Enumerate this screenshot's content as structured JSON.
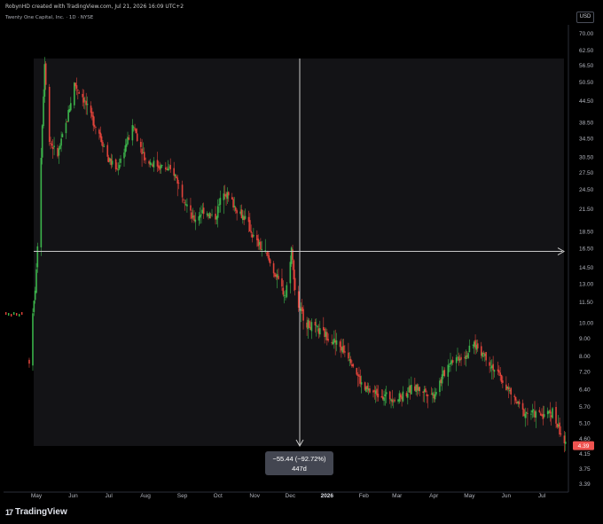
{
  "header": {
    "credit": "RobynHD created with TradingView.com, Jul 21, 2026 16:09 UTC+2",
    "symbol": "Twenty One Capital, Inc. · 1D · NYSE",
    "currency": "USD"
  },
  "footer": {
    "brand": "TradingView"
  },
  "colors": {
    "up": "#26a69a",
    "down": "#ef5350",
    "upBright": "#3cb44b",
    "downBright": "#e0433a",
    "background": "#000000",
    "plotArea": "#131316",
    "crosshair": "#c8c8c8"
  },
  "measure": {
    "change": "−55.44 (−92.72%)",
    "bars": "447d"
  },
  "last_price": "4.39",
  "chart_data": {
    "type": "candlestick",
    "title": "",
    "xlabel": "",
    "ylabel": "",
    "x_tick_labels": [
      "May",
      "Jun",
      "Jul",
      "Aug",
      "Sep",
      "Oct",
      "Nov",
      "Dec",
      "2026",
      "Feb",
      "Mar",
      "Apr",
      "May",
      "Jun",
      "Jul"
    ],
    "y_tick_labels": [
      "70.00",
      "62.50",
      "56.50",
      "50.50",
      "44.50",
      "38.50",
      "34.50",
      "30.50",
      "27.50",
      "24.50",
      "21.50",
      "18.50",
      "16.50",
      "14.50",
      "13.00",
      "11.50",
      "10.00",
      "9.00",
      "8.00",
      "7.20",
      "6.40",
      "5.70",
      "5.10",
      "4.60",
      "4.15",
      "3.75",
      "3.39"
    ],
    "y_scale": "log",
    "ylim": [
      3.39,
      70.0
    ],
    "series": [
      {
        "values": [
          {
            "date": "2025-04-25",
            "price": 7.8
          },
          {
            "date": "2025-05-01",
            "price": 14.0
          },
          {
            "date": "2025-05-05",
            "price": 31.0
          },
          {
            "date": "2025-05-08",
            "price": 58.0
          },
          {
            "date": "2025-05-12",
            "price": 34.0
          },
          {
            "date": "2025-05-19",
            "price": 31.0
          },
          {
            "date": "2025-05-26",
            "price": 38.0
          },
          {
            "date": "2025-06-02",
            "price": 50.0
          },
          {
            "date": "2025-06-09",
            "price": 46.0
          },
          {
            "date": "2025-06-16",
            "price": 40.0
          },
          {
            "date": "2025-06-23",
            "price": 36.0
          },
          {
            "date": "2025-07-01",
            "price": 30.0
          },
          {
            "date": "2025-07-08",
            "price": 28.0
          },
          {
            "date": "2025-07-15",
            "price": 33.0
          },
          {
            "date": "2025-07-22",
            "price": 37.5
          },
          {
            "date": "2025-08-01",
            "price": 30.0
          },
          {
            "date": "2025-08-15",
            "price": 28.5
          },
          {
            "date": "2025-08-25",
            "price": 27.5
          },
          {
            "date": "2025-09-01",
            "price": 24.0
          },
          {
            "date": "2025-09-10",
            "price": 20.0
          },
          {
            "date": "2025-09-20",
            "price": 21.5
          },
          {
            "date": "2025-09-28",
            "price": 20.0
          },
          {
            "date": "2025-10-06",
            "price": 24.5
          },
          {
            "date": "2025-10-15",
            "price": 22.0
          },
          {
            "date": "2025-10-25",
            "price": 20.0
          },
          {
            "date": "2025-11-01",
            "price": 17.5
          },
          {
            "date": "2025-11-10",
            "price": 16.0
          },
          {
            "date": "2025-11-20",
            "price": 13.5
          },
          {
            "date": "2025-11-27",
            "price": 12.0
          },
          {
            "date": "2025-12-02",
            "price": 16.5
          },
          {
            "date": "2025-12-06",
            "price": 11.5
          },
          {
            "date": "2025-12-15",
            "price": 10.0
          },
          {
            "date": "2025-12-25",
            "price": 9.5
          },
          {
            "date": "2026-01-05",
            "price": 9.0
          },
          {
            "date": "2026-01-20",
            "price": 8.0
          },
          {
            "date": "2026-02-01",
            "price": 6.4
          },
          {
            "date": "2026-02-15",
            "price": 6.2
          },
          {
            "date": "2026-03-01",
            "price": 6.0
          },
          {
            "date": "2026-03-15",
            "price": 6.5
          },
          {
            "date": "2026-04-01",
            "price": 6.2
          },
          {
            "date": "2026-04-15",
            "price": 7.8
          },
          {
            "date": "2026-04-28",
            "price": 8.1
          },
          {
            "date": "2026-05-05",
            "price": 8.7
          },
          {
            "date": "2026-05-15",
            "price": 8.0
          },
          {
            "date": "2026-06-01",
            "price": 6.5
          },
          {
            "date": "2026-06-15",
            "price": 5.5
          },
          {
            "date": "2026-07-01",
            "price": 5.4
          },
          {
            "date": "2026-07-10",
            "price": 5.5
          },
          {
            "date": "2026-07-21",
            "price": 4.39
          }
        ]
      }
    ]
  }
}
